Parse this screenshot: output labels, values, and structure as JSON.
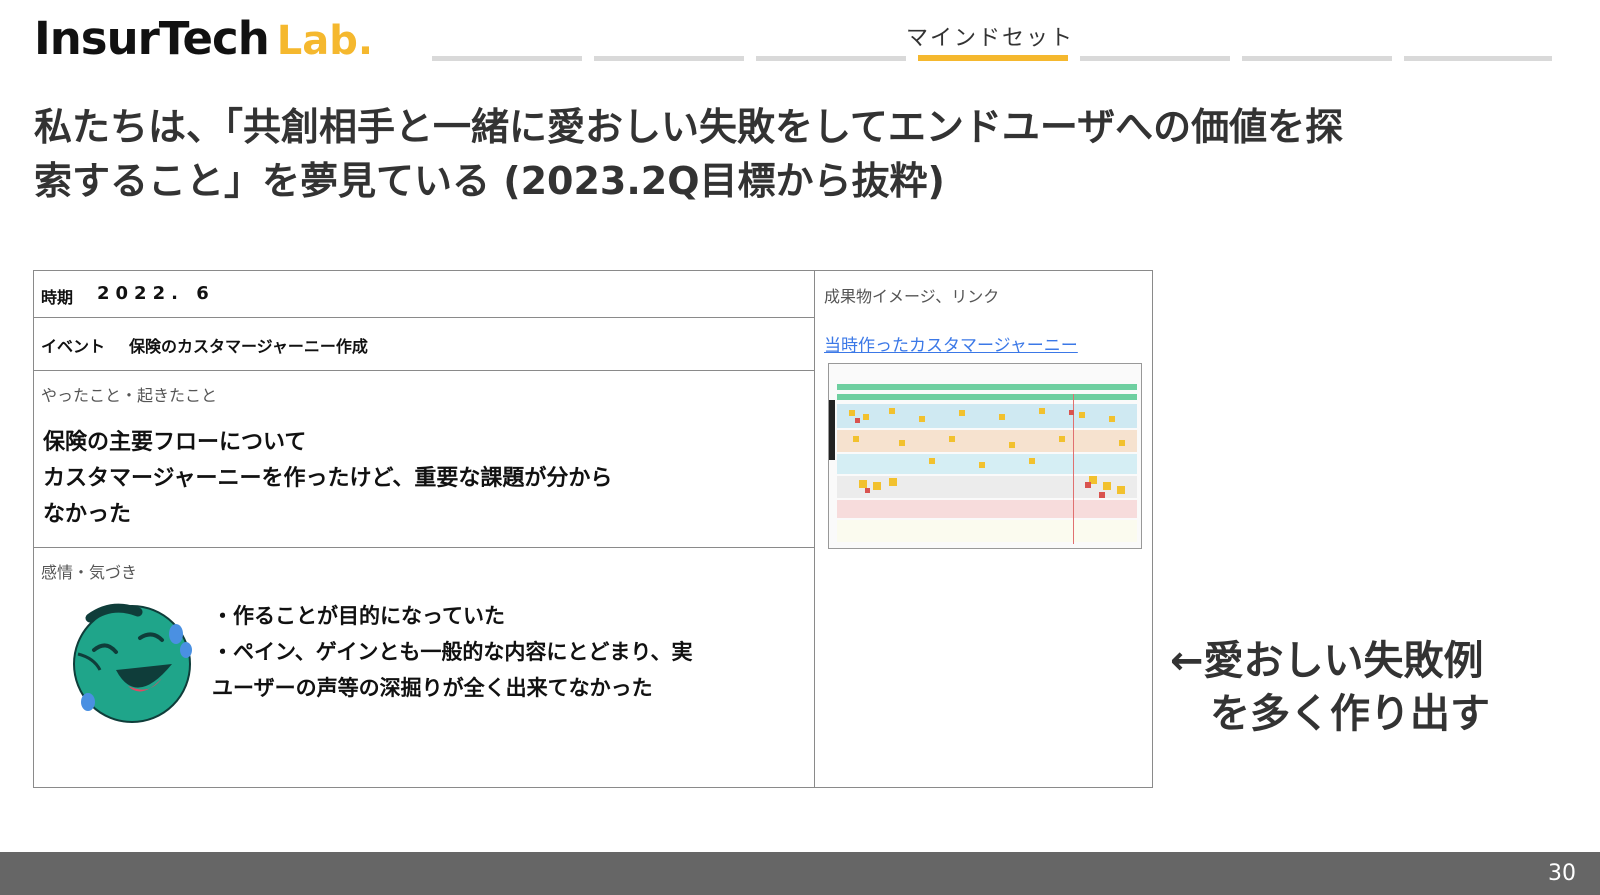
{
  "brand": {
    "main": "InsurTech",
    "sub": "Lab.",
    "accent_color": "#f5b82e"
  },
  "progress": {
    "label": "マインドセット",
    "segments_total": 7,
    "active_index": 3
  },
  "headline": {
    "line1": "私たちは、「共創相手と一緒に愛おしい失敗をしてエンドユーザへの価値を探",
    "line2": "索すること」を夢見ている (2023.2Q目標から抜粋)"
  },
  "record": {
    "period_label": "時期",
    "period_value": "2022. 6",
    "event_label": "イベント",
    "event_value": "保険のカスタマージャーニー作成",
    "done_label": "やったこと・起きたこと",
    "done_lines": [
      "保険の主要フローについて",
      "カスタマージャーニーを作ったけど、重要な課題が分から",
      "なかった"
    ],
    "feel_label": "感情・気づき",
    "feel_lines": [
      "・作ることが目的になっていた",
      "・ペイン、ゲインとも一般的な内容にとどまり、実",
      "ユーザーの声等の深掘りが全く出来てなかった"
    ],
    "face_icon": "laughing-crying-face-icon",
    "artifact_label": "成果物イメージ、リンク",
    "artifact_link": "当時作ったカスタマージャーニー",
    "link_color": "#3b78e7"
  },
  "callout": {
    "line1": "←愛おしい失敗例",
    "line2": "を多く作り出す"
  },
  "footer": {
    "page_number": "30"
  }
}
